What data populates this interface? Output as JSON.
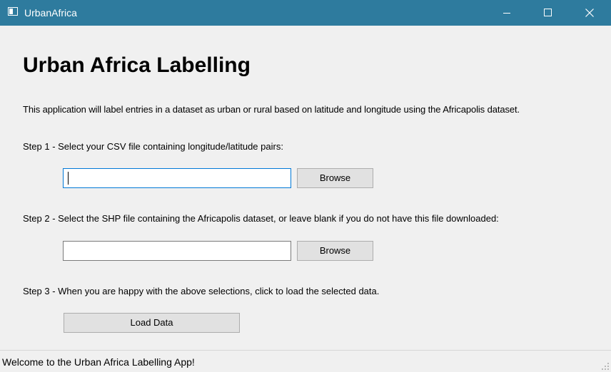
{
  "window": {
    "title": "UrbanAfrica",
    "titlebar_color": "#2e7b9e",
    "icons": {
      "app": "app-window-icon",
      "minimize": "minimize-icon",
      "maximize": "maximize-icon",
      "close": "close-icon"
    }
  },
  "main": {
    "heading": "Urban Africa Labelling",
    "description": "This application will label entries in a dataset as urban or rural based on latitude and longitude using the Africapolis dataset.",
    "step1": {
      "label": "Step 1 - Select your CSV file containing longitude/latitude pairs:",
      "input_value": "",
      "browse_label": "Browse"
    },
    "step2": {
      "label": "Step 2 - Select the SHP file containing the Africapolis dataset, or leave blank if you do not have this file downloaded:",
      "input_value": "",
      "browse_label": "Browse"
    },
    "step3": {
      "label": "Step 3 - When you are happy with the above selections, click to load the selected data.",
      "load_label": "Load Data"
    }
  },
  "statusbar": {
    "message": "Welcome to the Urban Africa Labelling App!",
    "grip_icon": "resize-grip-icon"
  },
  "colors": {
    "focus_border": "#0078d7",
    "button_bg": "#e1e1e1",
    "background": "#f0f0f0"
  }
}
